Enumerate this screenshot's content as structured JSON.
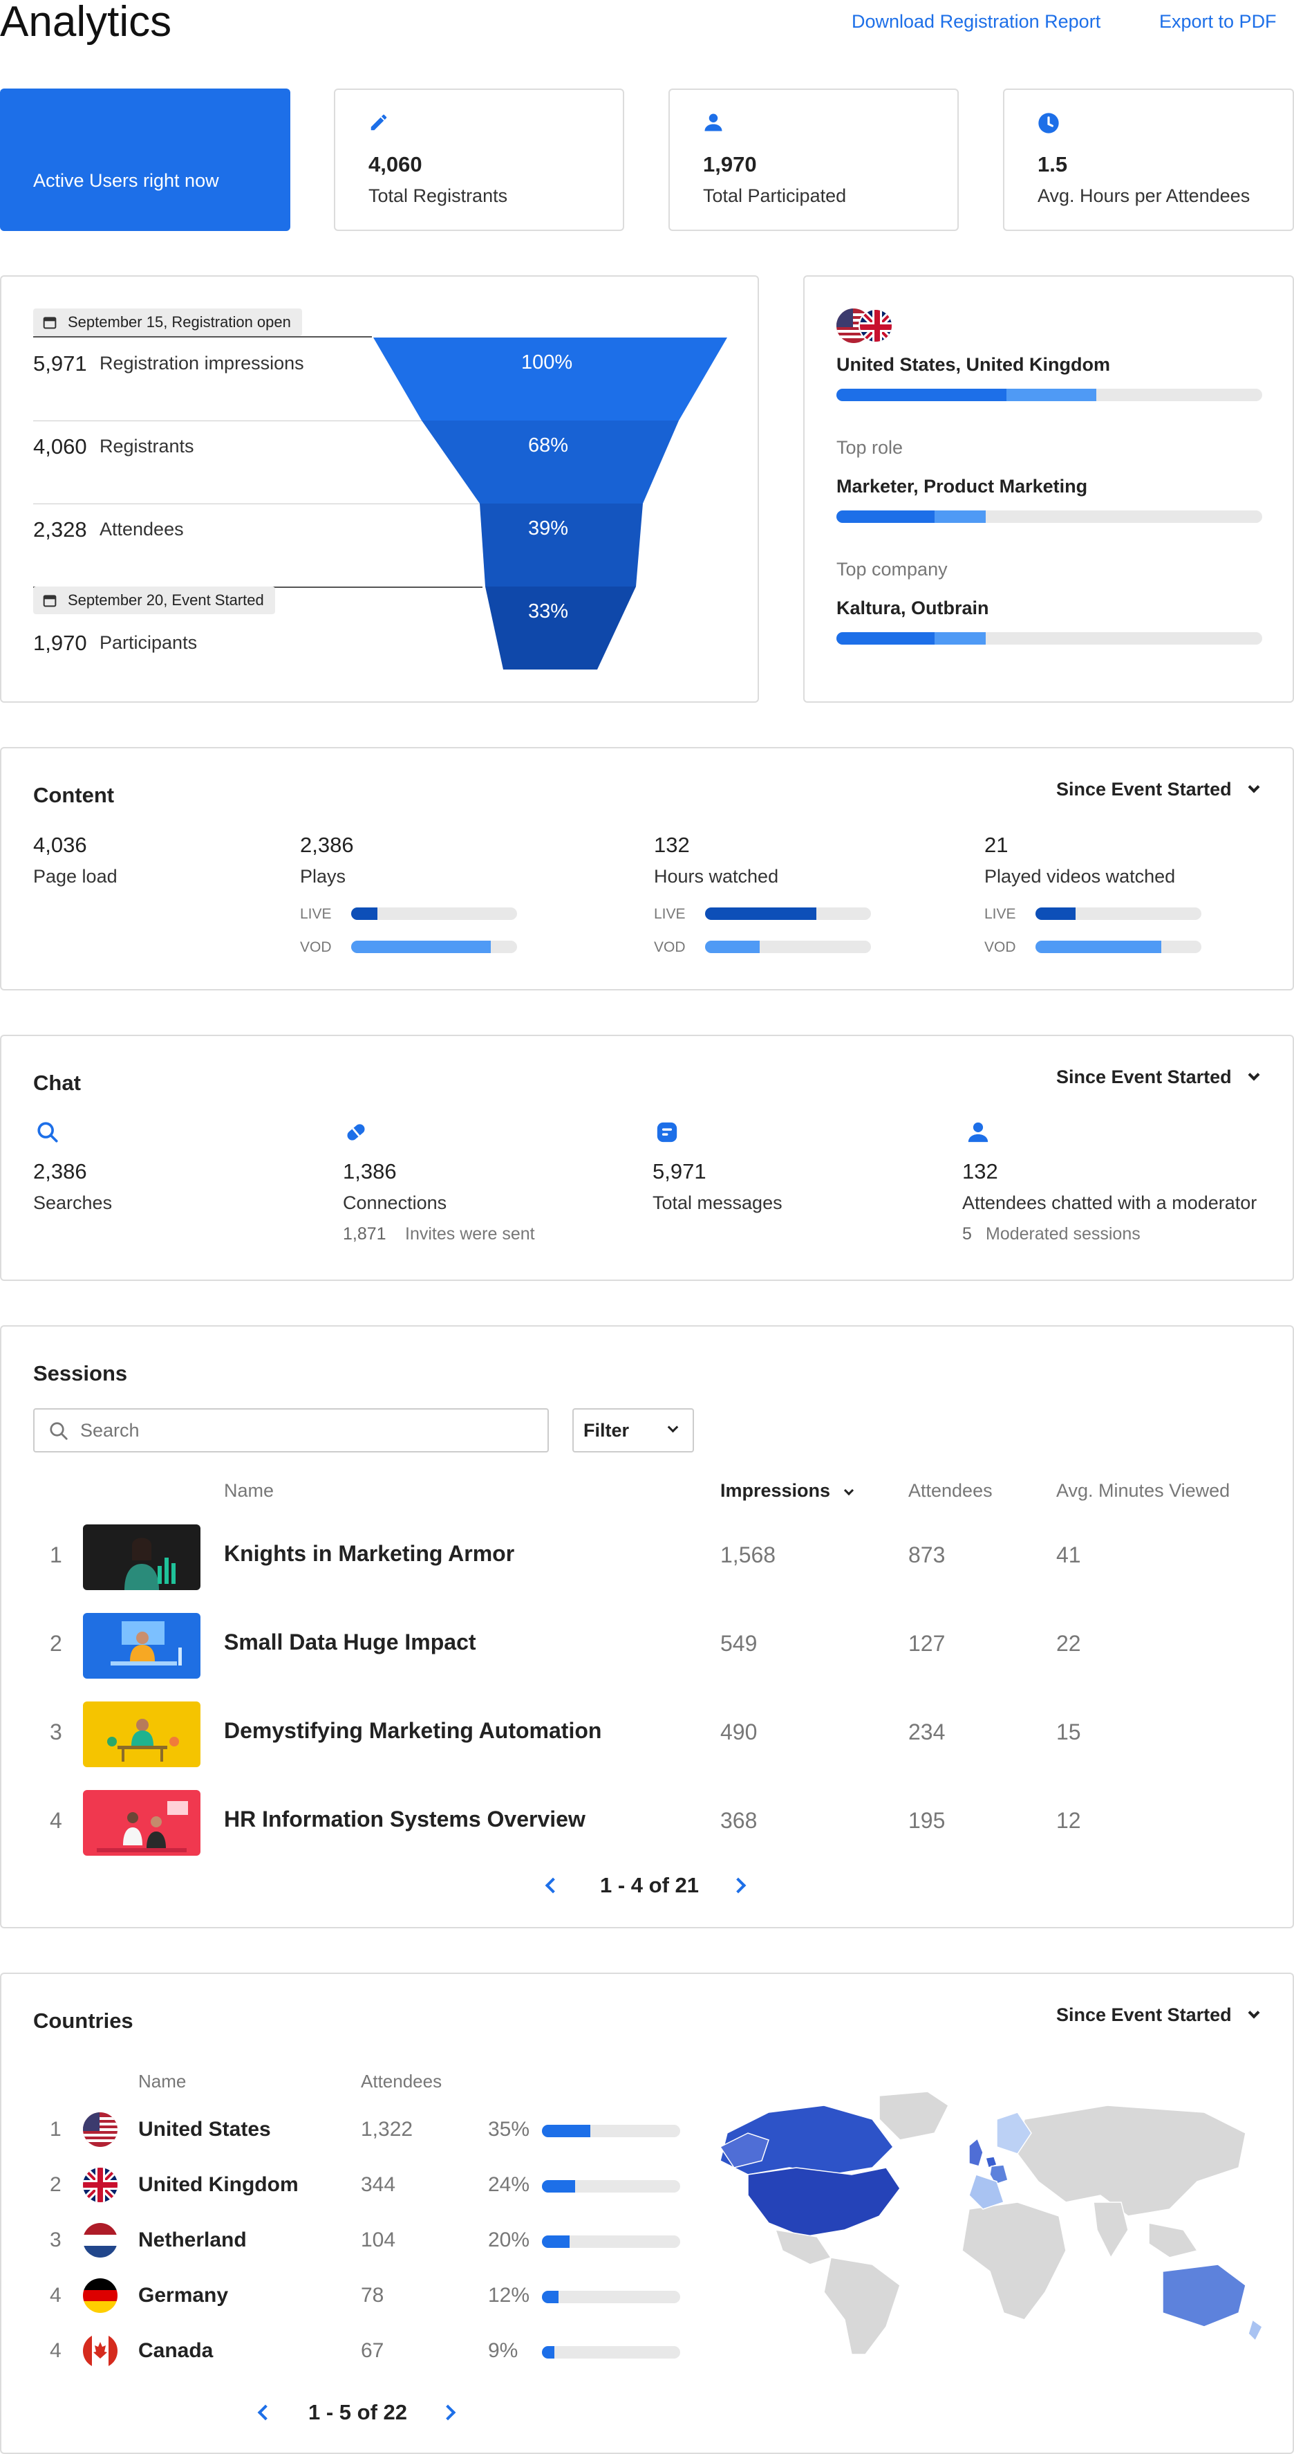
{
  "header": {
    "title": "Analytics",
    "download_label": "Download Registration Report",
    "export_label": "Export to PDF"
  },
  "stats": {
    "active_label": "Active Users right now",
    "registrants_value": "4,060",
    "registrants_label": "Total Registrants",
    "participated_value": "1,970",
    "participated_label": "Total Participated",
    "hours_value": "1.5",
    "hours_label": "Avg. Hours per Attendees"
  },
  "funnel": {
    "tag_open": "September 15, Registration open",
    "tag_started": "September 20, Event Started",
    "rows": [
      {
        "value": "5,971",
        "label": "Registration impressions",
        "pct": "100%"
      },
      {
        "value": "4,060",
        "label": "Registrants",
        "pct": "68%"
      },
      {
        "value": "2,328",
        "label": "Attendees",
        "pct": "39%"
      },
      {
        "value": "1,970",
        "label": "Participants",
        "pct": "33%"
      }
    ]
  },
  "top": {
    "countries": "United States, United Kingdom",
    "countries_bar": [
      0.4,
      0.21
    ],
    "role_label": "Top role",
    "role": "Marketer, Product Marketing",
    "role_bar": [
      0.23,
      0.12
    ],
    "company_label": "Top company",
    "company": "Kaltura, Outbrain",
    "company_bar": [
      0.23,
      0.12
    ]
  },
  "content": {
    "title": "Content",
    "range": "Since Event Started",
    "page_load_value": "4,036",
    "page_load_label": "Page load",
    "plays_value": "2,386",
    "plays_label": "Plays",
    "hours_value": "132",
    "hours_label": "Hours watched",
    "played_value": "21",
    "played_label": "Played videos watched",
    "live_label": "LIVE",
    "vod_label": "VOD",
    "plays_live": 0.16,
    "plays_vod": 0.84,
    "hours_live": 0.67,
    "hours_vod": 0.33,
    "played_live": 0.24,
    "played_vod": 0.76
  },
  "chat": {
    "title": "Chat",
    "range": "Since Event Started",
    "searches_value": "2,386",
    "searches_label": "Searches",
    "connections_value": "1,386",
    "connections_label": "Connections",
    "invites_value": "1,871",
    "invites_label": "Invites were sent",
    "messages_value": "5,971",
    "messages_label": "Total messages",
    "moderator_value": "132",
    "moderator_label": "Attendees chatted with a moderator",
    "moderated_value": "5",
    "moderated_label": "Moderated sessions"
  },
  "sessions": {
    "title": "Sessions",
    "search_placeholder": "Search",
    "filter_label": "Filter",
    "col_name": "Name",
    "col_impressions": "Impressions",
    "col_attendees": "Attendees",
    "col_avg": "Avg. Minutes Viewed",
    "rows": [
      {
        "rank": "1",
        "name": "Knights in Marketing Armor",
        "impressions": "1,568",
        "attendees": "873",
        "avg": "41",
        "thumb_color": "#1c1c1c"
      },
      {
        "rank": "2",
        "name": "Small Data Huge Impact",
        "impressions": "549",
        "attendees": "127",
        "avg": "22",
        "thumb_color": "#1f6fe3"
      },
      {
        "rank": "3",
        "name": "Demystifying Marketing Automation",
        "impressions": "490",
        "attendees": "234",
        "avg": "15",
        "thumb_color": "#f5c400"
      },
      {
        "rank": "4",
        "name": "HR Information Systems Overview",
        "impressions": "368",
        "attendees": "195",
        "avg": "12",
        "thumb_color": "#f0384f"
      }
    ],
    "pager": "1 - 4 of 21"
  },
  "countries": {
    "title": "Countries",
    "range": "Since Event Started",
    "col_name": "Name",
    "col_attendees": "Attendees",
    "rows": [
      {
        "rank": "1",
        "name": "United States",
        "attendees": "1,322",
        "pct": "35%",
        "fraction": 0.35,
        "flag": "us-flag"
      },
      {
        "rank": "2",
        "name": "United Kingdom",
        "attendees": "344",
        "pct": "24%",
        "fraction": 0.24,
        "flag": "uk-flag"
      },
      {
        "rank": "3",
        "name": "Netherland",
        "attendees": "104",
        "pct": "20%",
        "fraction": 0.2,
        "flag": "nl-flag"
      },
      {
        "rank": "4",
        "name": "Germany",
        "attendees": "78",
        "pct": "12%",
        "fraction": 0.12,
        "flag": "de-flag"
      },
      {
        "rank": "4",
        "name": "Canada",
        "attendees": "67",
        "pct": "9%",
        "fraction": 0.09,
        "flag": "ca-flag"
      }
    ],
    "pager": "1 - 5 of 22"
  },
  "colors": {
    "accent": "#1d6fe8",
    "accent_dark": "#0d4fb8",
    "accent_light": "#4f9af5",
    "funnel": [
      "#1d6fe8",
      "#1862d4",
      "#1455bf",
      "#0f48aa"
    ]
  }
}
